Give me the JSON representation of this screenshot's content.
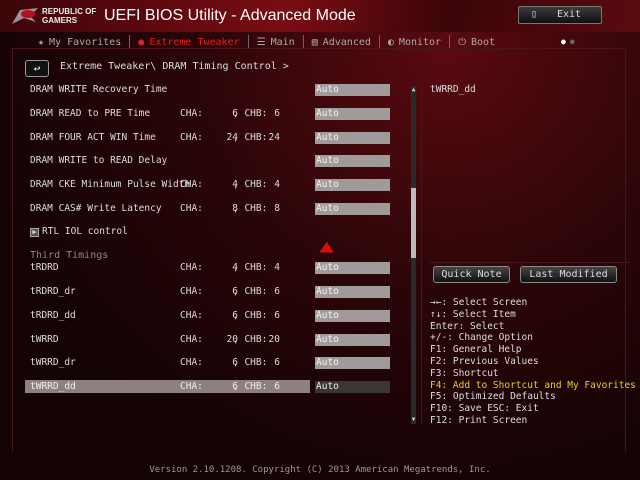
{
  "header": {
    "brand_line1": "REPUBLIC OF",
    "brand_line2": "GAMERS",
    "title": "UEFI BIOS Utility - Advanced Mode",
    "exit_label": "Exit"
  },
  "tabs": [
    {
      "label": "My Favorites",
      "icon": "star-icon"
    },
    {
      "label": "Extreme Tweaker",
      "icon": "tweaker-icon",
      "active": true
    },
    {
      "label": "Main",
      "icon": "list-icon"
    },
    {
      "label": "Advanced",
      "icon": "advanced-icon"
    },
    {
      "label": "Monitor",
      "icon": "monitor-icon"
    },
    {
      "label": "Boot",
      "icon": "power-icon"
    }
  ],
  "breadcrumb": "Extreme Tweaker\\ DRAM Timing Control >",
  "items": [
    {
      "label": "DRAM WRITE Recovery Time",
      "cha": "",
      "chb": "",
      "value": "Auto"
    },
    {
      "label": "DRAM READ to PRE Time",
      "cha": "6",
      "chb": "6",
      "value": "Auto"
    },
    {
      "label": "DRAM FOUR ACT WIN Time",
      "cha": "24",
      "chb": "24",
      "value": "Auto"
    },
    {
      "label": "DRAM WRITE to READ Delay",
      "cha": "",
      "chb": "",
      "value": "Auto"
    },
    {
      "label": "DRAM CKE Minimum Pulse Width",
      "cha": "4",
      "chb": "4",
      "value": "Auto"
    },
    {
      "label": "DRAM CAS# Write Latency",
      "cha": "8",
      "chb": "8",
      "value": "Auto"
    }
  ],
  "submenu": "RTL IOL control",
  "section_title": "Third Timings",
  "third": [
    {
      "label": "tRDRD",
      "cha": "4",
      "chb": "4",
      "value": "Auto"
    },
    {
      "label": "tRDRD_dr",
      "cha": "6",
      "chb": "6",
      "value": "Auto"
    },
    {
      "label": "tRDRD_dd",
      "cha": "6",
      "chb": "6",
      "value": "Auto"
    },
    {
      "label": "tWRRD",
      "cha": "20",
      "chb": "20",
      "value": "Auto"
    },
    {
      "label": "tWRRD_dr",
      "cha": "6",
      "chb": "6",
      "value": "Auto"
    },
    {
      "label": "tWRRD_dd",
      "cha": "6",
      "chb": "6",
      "value": "Auto",
      "selected": true
    }
  ],
  "cha_label": "CHA:",
  "chb_label": ", CHB:",
  "help_title": "tWRRD_dd",
  "quick_note": "Quick Note",
  "last_modified": "Last Modified",
  "keys": [
    "→←: Select Screen",
    "↑↓: Select Item",
    "Enter: Select",
    "+/-: Change Option",
    "F1: General Help",
    "F2: Previous Values",
    "F3: Shortcut",
    "F4: Add to Shortcut and My Favorites",
    "F5: Optimized Defaults",
    "F10: Save  ESC: Exit",
    "F12: Print Screen"
  ],
  "footer": "Version 2.10.1208. Copyright (C) 2013 American Megatrends, Inc.",
  "colors": {
    "accent": "#e02020",
    "highlight_key": "#e8d020"
  }
}
